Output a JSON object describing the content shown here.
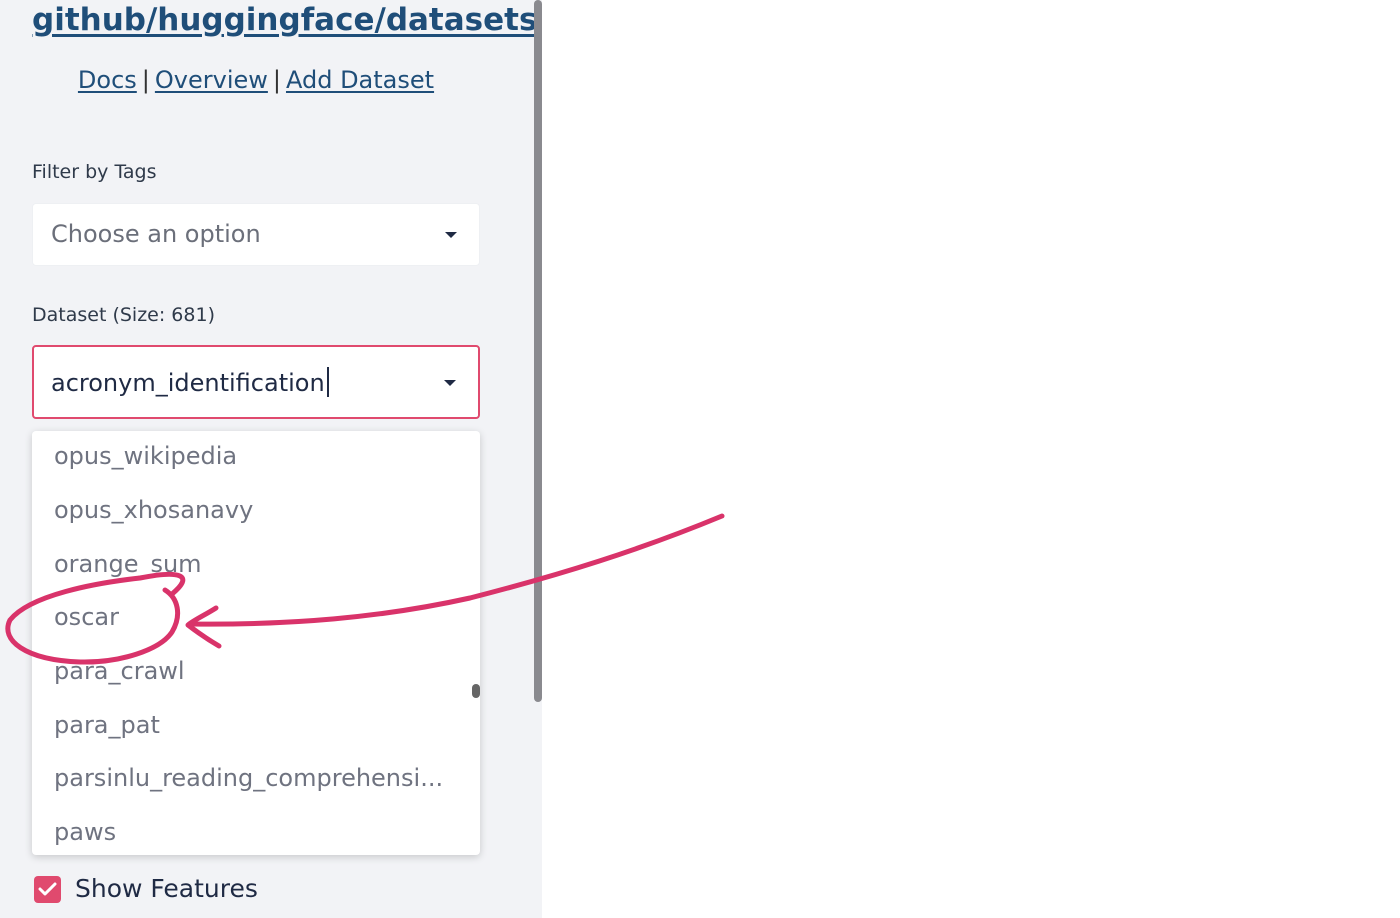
{
  "sidebar": {
    "repo_link": "github/huggingface/datasets",
    "nav": {
      "docs": "Docs",
      "overview": "Overview",
      "add_dataset": "Add Dataset",
      "separator": "|"
    },
    "filter_label": "Filter by Tags",
    "filter_placeholder": "Choose an option",
    "dataset_label": "Dataset (Size: 681)",
    "dataset_value": "acronym_identification",
    "dropdown_options": [
      "opus_wikipedia",
      "opus_xhosanavy",
      "orange_sum",
      "oscar",
      "para_crawl",
      "para_pat",
      "parsinlu_reading_comprehensi...",
      "paws"
    ],
    "show_features_label": "Show Features",
    "show_features_checked": true
  },
  "colors": {
    "accent": "#e04a6e",
    "link": "#1f4e79",
    "sidebar_bg": "#f2f3f6",
    "annotation": "#d9336a"
  }
}
